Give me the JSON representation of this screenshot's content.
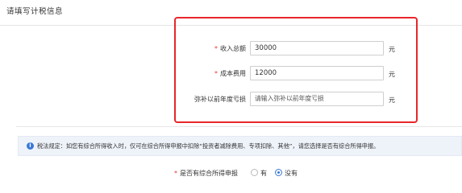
{
  "section": {
    "title": "请填写计税信息"
  },
  "form": {
    "rows": [
      {
        "required": true,
        "label": "收入总额",
        "value": "30000",
        "placeholder": "",
        "unit": "元"
      },
      {
        "required": true,
        "label": "成本费用",
        "value": "12000",
        "placeholder": "",
        "unit": "元"
      },
      {
        "required": false,
        "label": "弥补以前年度亏损",
        "value": "",
        "placeholder": "请输入弥补以前年度亏损",
        "unit": "元"
      }
    ],
    "required_mark": "*"
  },
  "notice": {
    "icon": "info-icon",
    "text": "税法规定：如您有综合所得收入时，仅可在综合所得申报中扣除“投资者减除费用、专项扣除、其他”，请您选择是否有综合所得申报。"
  },
  "question": {
    "required_mark": "*",
    "label": "是否有综合所得申报",
    "options": [
      {
        "label": "有",
        "selected": false
      },
      {
        "label": "没有",
        "selected": true
      }
    ]
  },
  "colors": {
    "highlight_border": "#e8262a",
    "accent": "#3a78d6",
    "required": "#e23b3b",
    "notice_bg": "#eef3fa"
  }
}
